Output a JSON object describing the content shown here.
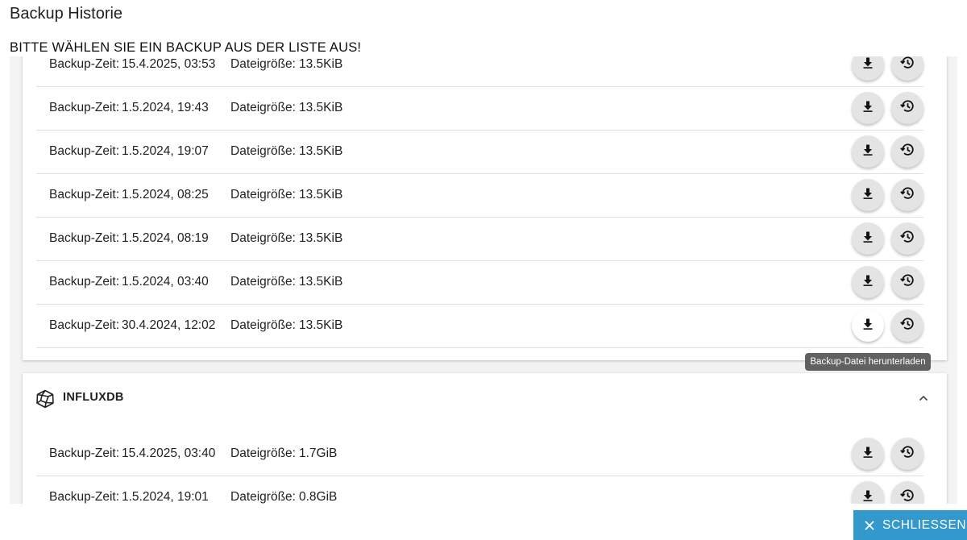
{
  "dialog": {
    "title": "Backup Historie",
    "subtitle": "BITTE WÄHLEN SIE EIN BACKUP AUS DER LISTE AUS!"
  },
  "labels": {
    "time": "Backup-Zeit:",
    "size": "Dateigröße:"
  },
  "groups": [
    {
      "title": "",
      "icon": "none",
      "rows": [
        {
          "time": "15.4.2025, 03:53",
          "size": "13.5KiB"
        },
        {
          "time": "1.5.2024, 19:43",
          "size": "13.5KiB"
        },
        {
          "time": "1.5.2024, 19:07",
          "size": "13.5KiB"
        },
        {
          "time": "1.5.2024, 08:25",
          "size": "13.5KiB"
        },
        {
          "time": "1.5.2024, 08:19",
          "size": "13.5KiB"
        },
        {
          "time": "1.5.2024, 03:40",
          "size": "13.5KiB"
        },
        {
          "time": "30.4.2024, 12:02",
          "size": "13.5KiB"
        }
      ]
    },
    {
      "title": "INFLUXDB",
      "icon": "database-polyhedron-icon",
      "expanded": true,
      "rows": [
        {
          "time": "15.4.2025, 03:40",
          "size": "1.7GiB"
        },
        {
          "time": "1.5.2024, 19:01",
          "size": "0.8GiB"
        }
      ]
    }
  ],
  "tooltip": "Backup-Datei herunterladen",
  "buttons": {
    "close": "SCHLIESSEN",
    "download_icon": "download-icon",
    "restore_icon": "history-icon"
  },
  "colors": {
    "accent": "#3399cc",
    "tooltip_bg": "#616161",
    "icon_button_bg": "#e4e4e4"
  }
}
